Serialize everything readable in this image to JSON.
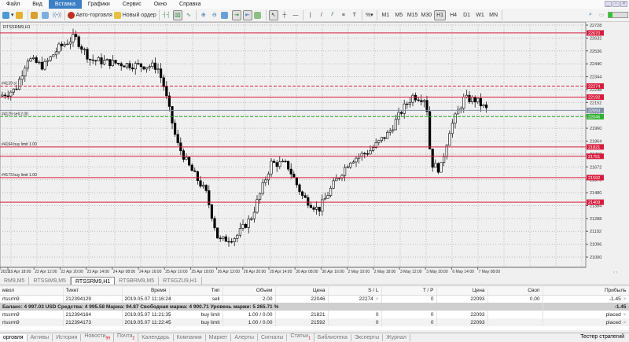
{
  "menu": [
    "Файл",
    "Вид",
    "Вставка",
    "Графики",
    "Сервис",
    "Окно",
    "Справка"
  ],
  "menu_active": 2,
  "toolbar": {
    "auto_trading": "Авто-торговля",
    "new_order": "Новый ордер",
    "timeframes": [
      "M1",
      "M5",
      "M15",
      "M30",
      "H1",
      "H4",
      "D1",
      "W1",
      "MN"
    ],
    "active_tf": "H1"
  },
  "chart": {
    "symbol_label": "RTSSRM9,H1",
    "price_ticks": [
      22728,
      22632,
      22536,
      22440,
      22344,
      22248,
      22152,
      22056,
      21960,
      21864,
      21768,
      21672,
      21576,
      21480,
      21384,
      21288,
      21192,
      21096,
      21000
    ],
    "price_range": [
      21000,
      22728
    ],
    "time_labels": [
      "2019",
      "19 Apr 18:00",
      "22 Apr 12:00",
      "22 Apr 20:00",
      "23 Apr 14:00",
      "24 Apr 08:00",
      "24 Apr 16:00",
      "25 Apr 10:00",
      "25 Apr 18:00",
      "26 Apr 12:00",
      "26 Apr 20:00",
      "29 Apr 14:00",
      "30 Apr 08:00",
      "30 Apr 16:00",
      "2 May 10:00",
      "2 May 18:00",
      "3 May 12:00",
      "3 May 20:00",
      "6 May 14:00",
      "7 May 08:00"
    ],
    "price_path": [
      [
        0,
        22200
      ],
      [
        20,
        22250
      ],
      [
        35,
        22480
      ],
      [
        55,
        22420
      ],
      [
        75,
        22560
      ],
      [
        95,
        22640
      ],
      [
        115,
        22470
      ],
      [
        140,
        22450
      ],
      [
        170,
        22430
      ],
      [
        200,
        22420
      ],
      [
        208,
        22280
      ],
      [
        225,
        21850
      ],
      [
        240,
        21680
      ],
      [
        262,
        21480
      ],
      [
        278,
        21120
      ],
      [
        300,
        21150
      ],
      [
        320,
        21300
      ],
      [
        345,
        21700
      ],
      [
        365,
        21690
      ],
      [
        385,
        21450
      ],
      [
        405,
        21350
      ],
      [
        425,
        21550
      ],
      [
        445,
        21720
      ],
      [
        470,
        21790
      ],
      [
        495,
        21930
      ],
      [
        512,
        22100
      ],
      [
        525,
        22200
      ],
      [
        542,
        22180
      ],
      [
        548,
        21700
      ],
      [
        560,
        21650
      ],
      [
        572,
        21950
      ],
      [
        590,
        22180
      ],
      [
        605,
        22170
      ],
      [
        620,
        22093
      ]
    ],
    "lines": [
      {
        "price": 22670,
        "label": "22670",
        "color": "#d81c3c",
        "style": "solid",
        "text": ""
      },
      {
        "price": 22274,
        "label": "22274",
        "color": "#d81c3c",
        "style": "dash",
        "text": "#4129 sl"
      },
      {
        "price": 22192,
        "label": "22192",
        "color": "#d81c3c",
        "style": "solid",
        "text": ""
      },
      {
        "price": 22093,
        "label": "22093",
        "color": "#8090a8",
        "style": "solid",
        "text": ""
      },
      {
        "price": 22046,
        "label": "22046",
        "color": "#30b030",
        "style": "dash",
        "text": "#4129 sell 2.00"
      },
      {
        "price": 21821,
        "label": "21821",
        "color": "#d81c3c",
        "style": "solid",
        "text": "#4164 buy limit 1.00"
      },
      {
        "price": 21751,
        "label": "21751",
        "color": "#d81c3c",
        "style": "solid",
        "text": ""
      },
      {
        "price": 21592,
        "label": "21592",
        "color": "#d81c3c",
        "style": "solid",
        "text": "#4173 buy limit 1.00"
      },
      {
        "price": 21409,
        "label": "21409",
        "color": "#d81c3c",
        "style": "solid",
        "text": ""
      }
    ]
  },
  "chart_tabs": [
    "RM9,M5",
    "RTSSiM9,M5",
    "RTSSRM9,H1",
    "RTSBRM9,M5",
    "RTSGZU9,H1"
  ],
  "chart_tab_active": 2,
  "table": {
    "headers": [
      "мвол",
      "Тикет",
      "Время",
      "Тип",
      "Объем",
      "Цена",
      "S / L",
      "T / P",
      "Цена",
      "Своп",
      "Прибыль"
    ],
    "rows": [
      [
        "rtssrm9",
        "212394129",
        "2019.05.07 11:16:24",
        "sell",
        "2.00",
        "22046",
        "22274",
        "0",
        "22093",
        "0.00",
        "-1.45"
      ]
    ],
    "summary": {
      "text": "Баланс: 4 997.03 USD  Средства: 4 995.58  Маржа: 94.87  Свободная маржа: 4 900.71  Уровень маржи: 5 265.71 %",
      "profit": "-1.45"
    },
    "pending": [
      [
        "rtssrm9",
        "212394164",
        "2019.05.07 11:21:35",
        "buy limit",
        "1.00 / 0.00",
        "21821",
        "0",
        "0",
        "22093",
        "",
        "placed"
      ],
      [
        "rtssrm9",
        "212394173",
        "2019.05.07 11:22:45",
        "buy limit",
        "1.00 / 0.00",
        "21592",
        "0",
        "0",
        "22093",
        "",
        "placed"
      ]
    ]
  },
  "bottom_tabs": [
    {
      "label": "орговля"
    },
    {
      "label": "Активы"
    },
    {
      "label": "История"
    },
    {
      "label": "Новости",
      "badge": "99"
    },
    {
      "label": "Почта",
      "badge": "2"
    },
    {
      "label": "Календарь"
    },
    {
      "label": "Компания"
    },
    {
      "label": "Маркет"
    },
    {
      "label": "Алерты"
    },
    {
      "label": "Сигналы"
    },
    {
      "label": "Статьи",
      "badge": "1"
    },
    {
      "label": "Библиотека"
    },
    {
      "label": "Эксперты"
    },
    {
      "label": "Журнал"
    }
  ],
  "tester": "Тестер стратегий"
}
